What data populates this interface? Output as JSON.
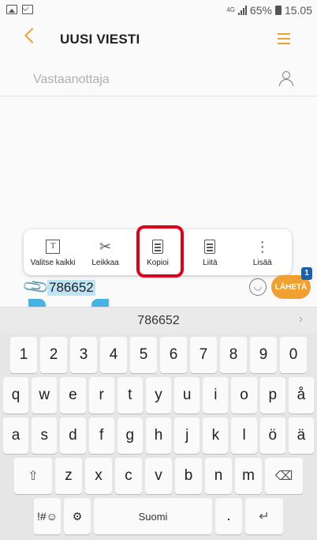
{
  "status": {
    "network": "4G",
    "battery": "65%",
    "time": "15.05"
  },
  "header": {
    "title": "UUSI VIESTI"
  },
  "recipient": {
    "placeholder": "Vastaanottaja"
  },
  "context_menu": {
    "items": [
      {
        "label": "Valitse kaikki"
      },
      {
        "label": "Leikkaa"
      },
      {
        "label": "Kopioi"
      },
      {
        "label": "Liitä"
      },
      {
        "label": "Lisää"
      }
    ]
  },
  "composer": {
    "text": "786652",
    "send_label": "LÄHETÄ",
    "badge": "1"
  },
  "suggestion": {
    "word": "786652"
  },
  "keyboard": {
    "row1": [
      "1",
      "2",
      "3",
      "4",
      "5",
      "6",
      "7",
      "8",
      "9",
      "0"
    ],
    "row2": [
      "q",
      "w",
      "e",
      "r",
      "t",
      "y",
      "u",
      "i",
      "o",
      "p",
      "å"
    ],
    "row3": [
      "a",
      "s",
      "d",
      "f",
      "g",
      "h",
      "j",
      "k",
      "l",
      "ö",
      "ä"
    ],
    "row4": [
      "z",
      "x",
      "c",
      "v",
      "b",
      "n",
      "m"
    ],
    "symbols_label": "!#☺",
    "space_label": "Suomi",
    "period_label": "."
  },
  "colors": {
    "accent": "#f0a030",
    "highlight": "#e0001a",
    "selection": "#47b2e4"
  }
}
